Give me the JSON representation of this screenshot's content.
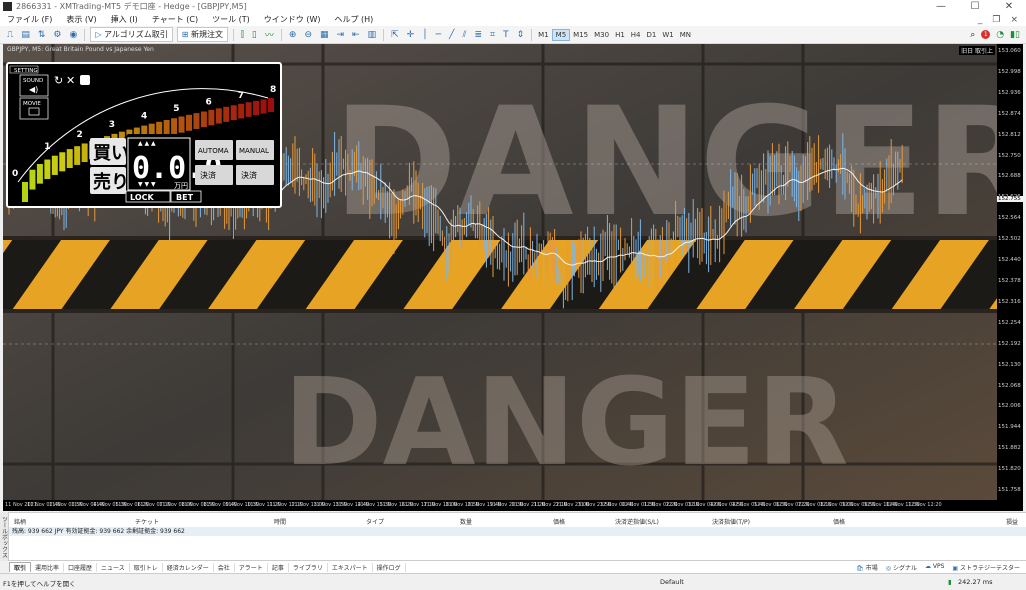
{
  "window": {
    "title": "2866331 - XMTrading-MT5 デモ口座 - Hedge - [GBPJPY,M5]",
    "controls": [
      "—",
      "☐",
      "✕"
    ]
  },
  "menu": {
    "items": [
      "ファイル (F)",
      "表示 (V)",
      "挿入 (I)",
      "チャート (C)",
      "ツール (T)",
      "ウインドウ (W)",
      "ヘルプ (H)"
    ]
  },
  "toolbar": {
    "algo_label": "アルゴリズム取引",
    "neworder_label": "新規注文",
    "timeframes": [
      "M1",
      "M5",
      "M15",
      "M30",
      "H1",
      "H4",
      "D1",
      "W1",
      "MN"
    ],
    "active_timeframe": "M5",
    "alert_count": "1"
  },
  "chart": {
    "header": "GBPJPY, M5:  Great Britain Pound vs Japanese Yen",
    "corner_label": "旧日 取引上",
    "background_word": "DANGER",
    "price_labels": [
      "153.060",
      "152.998",
      "152.936",
      "152.874",
      "152.812",
      "152.750",
      "152.688",
      "152.626",
      "152.564",
      "152.502",
      "152.440",
      "152.378",
      "152.316",
      "152.254",
      "152.192",
      "152.130",
      "152.068",
      "152.006",
      "151.944",
      "151.882",
      "151.820",
      "151.758"
    ],
    "current_price": "152.755",
    "time_labels": [
      "11 Nov 2021",
      "11 Nov 02:40",
      "11 Nov 03:50",
      "11 Nov 04:40",
      "11 Nov 05:30",
      "11 Nov 06:20",
      "11 Nov 07:10",
      "11 Nov 08:00",
      "11 Nov 08:50",
      "11 Nov 09:40",
      "11 Nov 10:30",
      "11 Nov 11:20",
      "11 Nov 12:10",
      "11 Nov 13:00",
      "11 Nov 13:50",
      "11 Nov 14:40",
      "11 Nov 15:30",
      "11 Nov 16:20",
      "11 Nov 17:10",
      "11 Nov 18:00",
      "11 Nov 18:50",
      "11 Nov 19:40",
      "11 Nov 20:30",
      "11 Nov 21:20",
      "11 Nov 22:10",
      "11 Nov 23:00",
      "11 Nov 23:50",
      "12 Nov 00:40",
      "12 Nov 01:30",
      "12 Nov 02:20",
      "12 Nov 03:10",
      "12 Nov 04:00",
      "12 Nov 04:50",
      "12 Nov 05:40",
      "12 Nov 06:30",
      "12 Nov 07:20",
      "12 Nov 08:10",
      "12 Nov 09:00",
      "12 Nov 09:50",
      "12 Nov 10:40",
      "12 Nov 11:30",
      "12 Nov 12:20"
    ]
  },
  "ea": {
    "setting": "SETTING",
    "sound": "SOUND",
    "movie": "MOVIE",
    "scale": [
      "0",
      "1",
      "2",
      "3",
      "4",
      "5",
      "6",
      "7",
      "8"
    ],
    "buy": "買い",
    "sell": "売り",
    "amount": "0.0.0",
    "unit": "万円",
    "auto": "AUTOMA",
    "manual": "MANUAL",
    "close_all": "決済",
    "close_sel": "決済",
    "lock": "LOCK",
    "bet": "BET"
  },
  "toolbox": {
    "side_label": "ツールボックス",
    "columns": [
      "銘柄",
      "チケット",
      "時間",
      "タイプ",
      "数量",
      "価格",
      "決済逆指値(S/L)",
      "決済指値(T/P)",
      "価格",
      "損益"
    ],
    "balance_row": "残高: 939 662 JPY  有効証拠金: 939 662  余剰証拠金: 939 662",
    "tabs": [
      "取引",
      "運用比率",
      "口座履歴",
      "ニュース",
      "取引トレ",
      "経済カレンダー",
      "会社",
      "アラート",
      "記事",
      "ライブラリ",
      "エキスパート",
      "操作ログ"
    ],
    "active_tab": "取引",
    "right_tabs": [
      "市場",
      "シグナル",
      "VPS",
      "ストラテジーテスター"
    ]
  },
  "status": {
    "help": "F1を押してヘルプを開く",
    "profile": "Default",
    "ping": "242.27 ms"
  }
}
